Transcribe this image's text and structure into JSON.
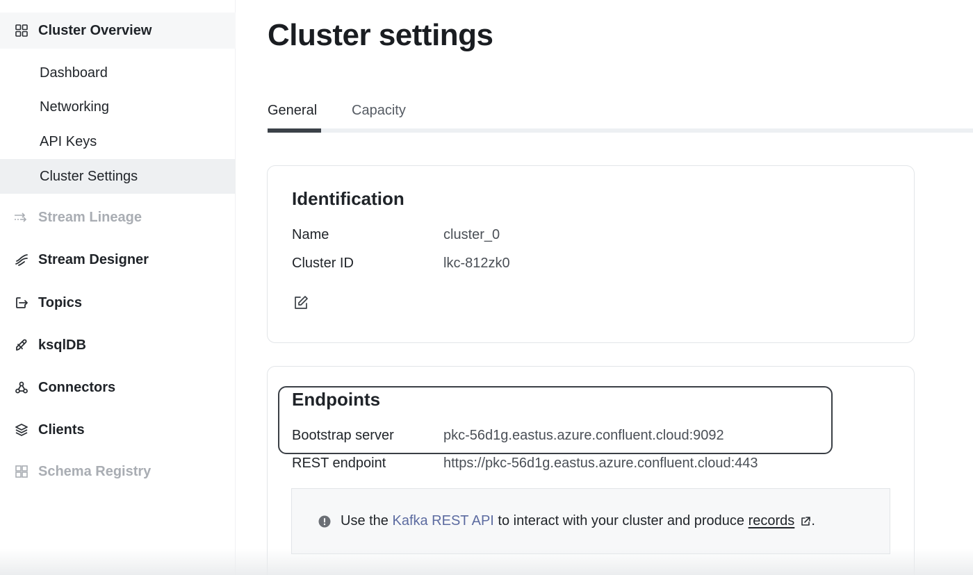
{
  "sidebar": {
    "cluster_overview": {
      "label": "Cluster Overview",
      "icon": "grid-icon"
    },
    "sub_items": [
      {
        "label": "Dashboard"
      },
      {
        "label": "Networking"
      },
      {
        "label": "API Keys"
      },
      {
        "label": "Cluster Settings",
        "active": true
      }
    ],
    "items": [
      {
        "label": "Stream Lineage",
        "icon": "stream-lineage-icon",
        "disabled": true
      },
      {
        "label": "Stream Designer",
        "icon": "stream-designer-icon"
      },
      {
        "label": "Topics",
        "icon": "topics-icon"
      },
      {
        "label": "ksqlDB",
        "icon": "ksqldb-icon"
      },
      {
        "label": "Connectors",
        "icon": "connectors-icon"
      },
      {
        "label": "Clients",
        "icon": "clients-icon"
      },
      {
        "label": "Schema Registry",
        "icon": "schema-registry-icon",
        "disabled": true
      }
    ]
  },
  "page": {
    "title": "Cluster settings",
    "tabs": [
      {
        "label": "General",
        "active": true
      },
      {
        "label": "Capacity"
      }
    ]
  },
  "identification": {
    "title": "Identification",
    "name_label": "Name",
    "name_value": "cluster_0",
    "cluster_id_label": "Cluster ID",
    "cluster_id_value": "lkc-812zk0",
    "edit_icon": "edit-icon"
  },
  "endpoints": {
    "title": "Endpoints",
    "bootstrap_label": "Bootstrap server",
    "bootstrap_value": "pkc-56d1g.eastus.azure.confluent.cloud:9092",
    "rest_label": "REST endpoint",
    "rest_value": "https://pkc-56d1g.eastus.azure.confluent.cloud:443",
    "info": {
      "icon": "alert-circle-icon",
      "text_before": "Use the ",
      "link_text": "Kafka REST API",
      "text_middle": " to interact with your cluster and produce ",
      "records_text": "records",
      "text_after": ".",
      "external_icon": "external-link-icon"
    }
  },
  "colors": {
    "accent_link": "#5c6ba0",
    "active_nav_bg": "#eef0f2",
    "disabled_text": "#a9adb3"
  }
}
